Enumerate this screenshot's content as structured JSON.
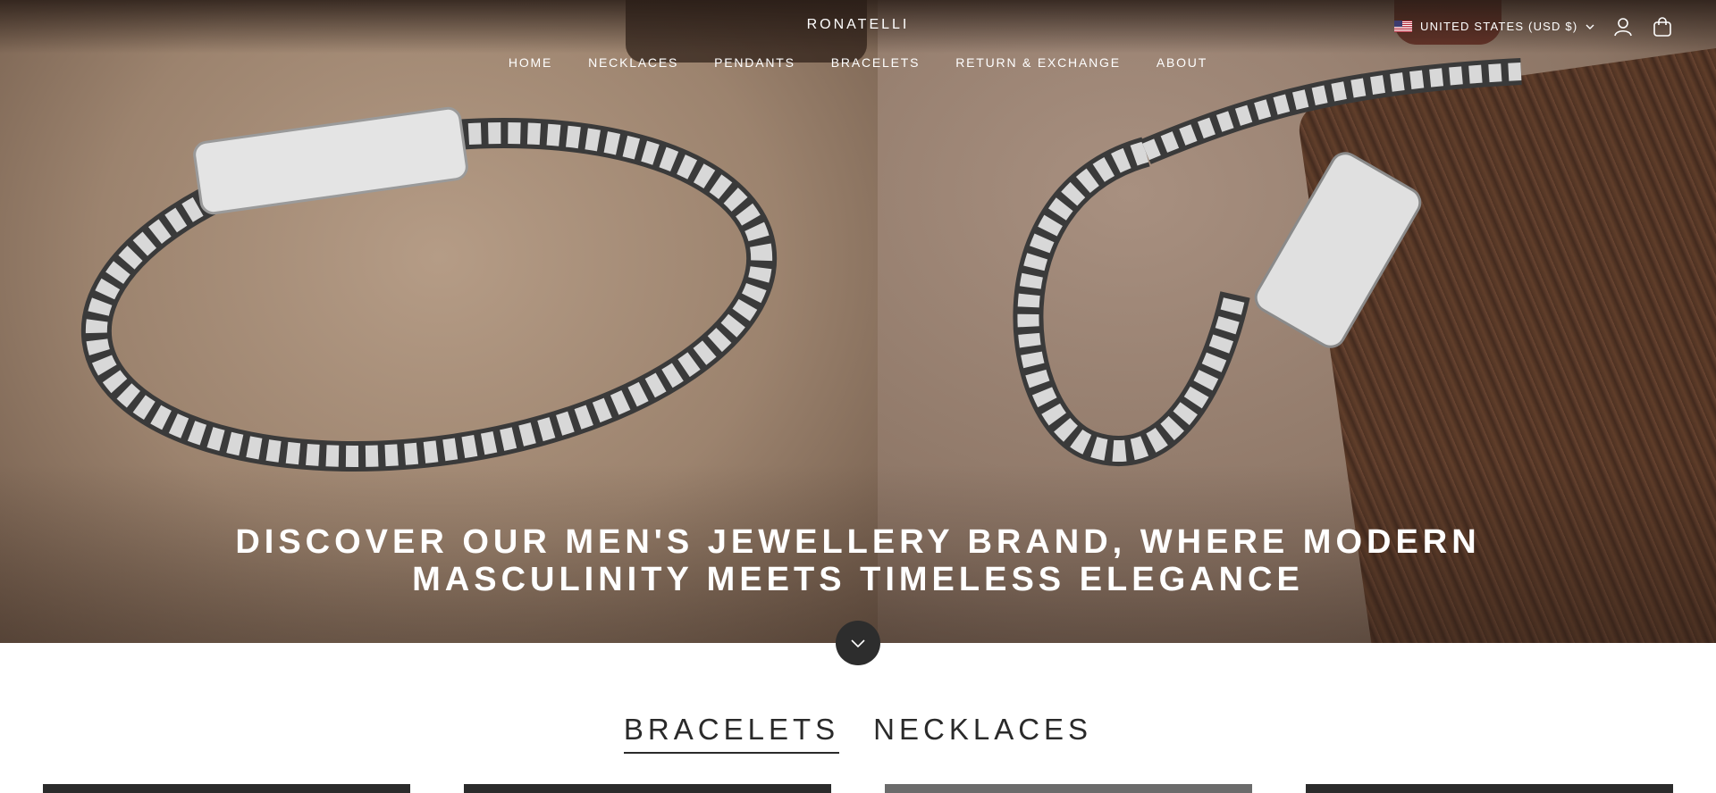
{
  "header": {
    "brand": "RONATELLI",
    "nav": [
      "HOME",
      "NECKLACES",
      "PENDANTS",
      "BRACELETS",
      "RETURN & EXCHANGE",
      "ABOUT"
    ],
    "locale": "UNITED STATES (USD $)",
    "icons": [
      "us-flag-icon",
      "chevron-down-icon",
      "account-icon",
      "cart-icon"
    ]
  },
  "hero": {
    "title_line1": "DISCOVER OUR MEN'S JEWELLERY BRAND, WHERE MODERN",
    "title_line2": "MASCULINITY MEETS TIMELESS ELEGANCE",
    "scroll_icon": "chevron-down-icon"
  },
  "collections": {
    "tabs": [
      "BRACELETS",
      "NECKLACES"
    ],
    "active_tab": "BRACELETS"
  }
}
